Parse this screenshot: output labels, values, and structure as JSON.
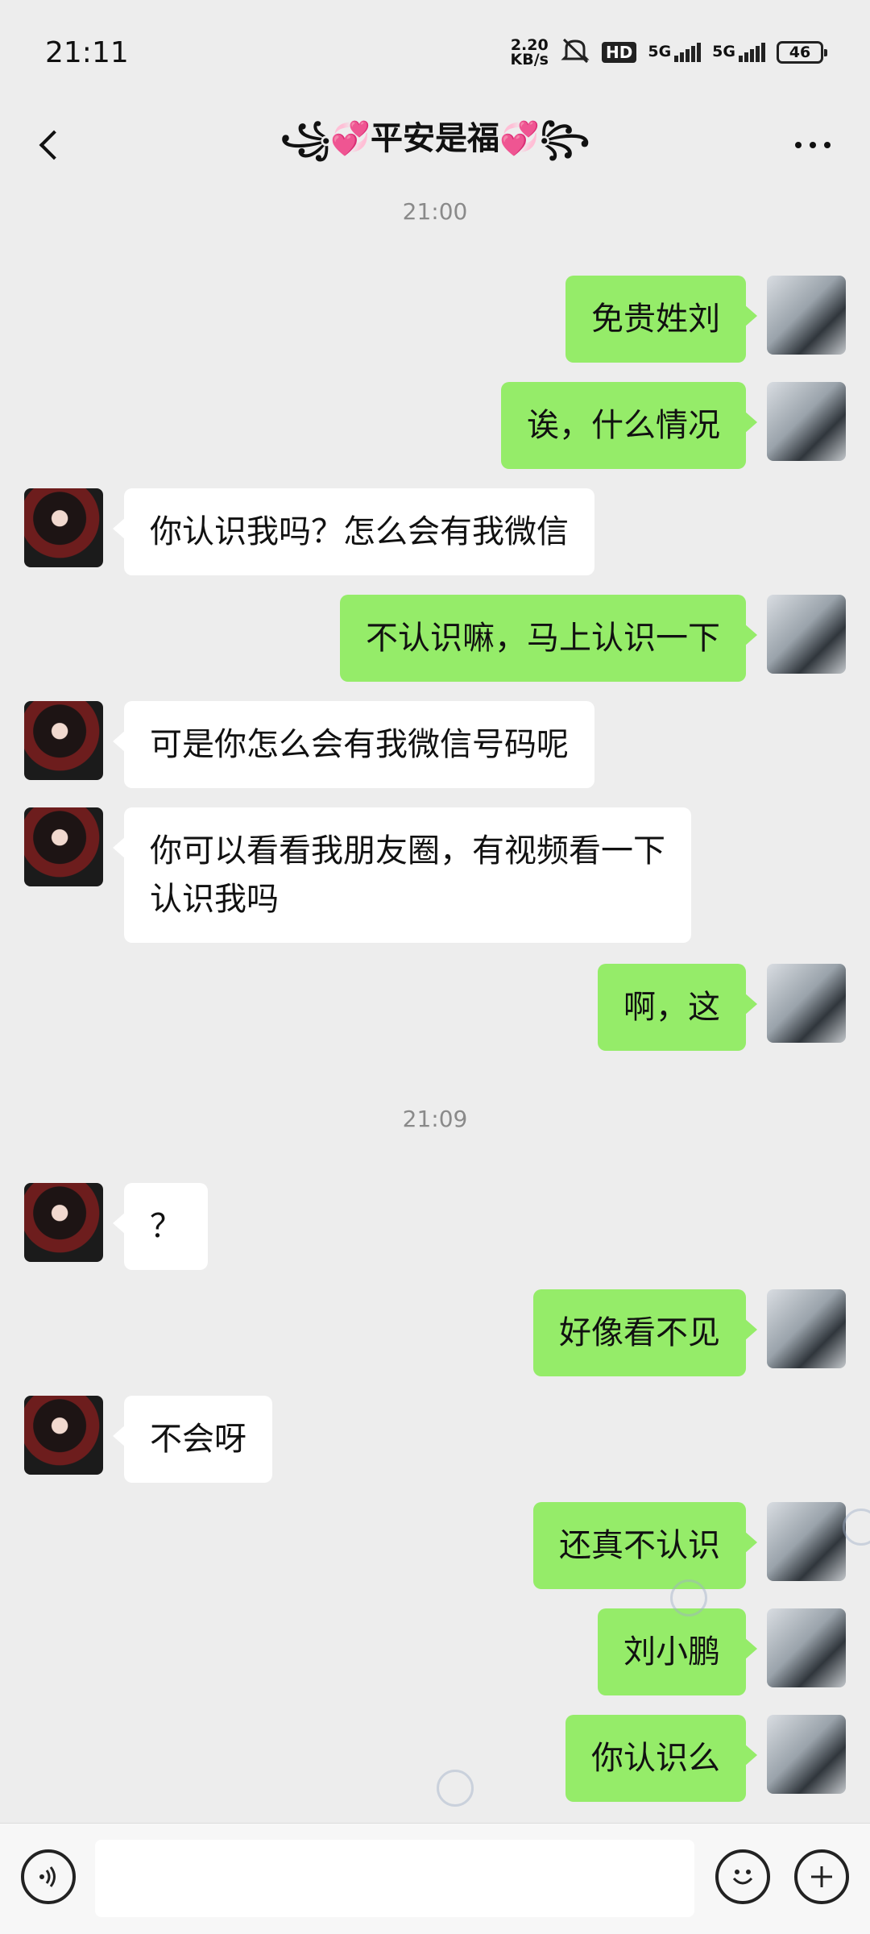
{
  "status_bar": {
    "time": "21:11",
    "net_speed_value": "2.20",
    "net_speed_unit": "KB/s",
    "hd_badge": "HD",
    "signal1_label": "5G",
    "signal2_label": "5G",
    "battery": "46"
  },
  "header": {
    "title": "꧁💞平安是福💞꧂",
    "icons": [
      "back-arrow-icon",
      "more-dots-icon"
    ]
  },
  "time_separators": [
    "21:00",
    "21:09"
  ],
  "messages": [
    {
      "from": "me",
      "text": "免贵姓刘"
    },
    {
      "from": "me",
      "text": "诶，什么情况"
    },
    {
      "from": "her",
      "text": "你认识我吗？怎么会有我微信"
    },
    {
      "from": "me",
      "text": "不认识嘛，马上认识一下"
    },
    {
      "from": "her",
      "text": "可是你怎么会有我微信号码呢"
    },
    {
      "from": "her",
      "text": "你可以看看我朋友圈，有视频看一下\n认识我吗"
    },
    {
      "from": "me",
      "text": "啊，这"
    },
    {
      "from": "her",
      "text": "？"
    },
    {
      "from": "me",
      "text": "好像看不见"
    },
    {
      "from": "her",
      "text": "不会呀"
    },
    {
      "from": "me",
      "text": "还真不认识"
    },
    {
      "from": "me",
      "text": "刘小鹏"
    },
    {
      "from": "me",
      "text": "你认识么"
    }
  ],
  "input_bar": {
    "placeholder": "",
    "icons": [
      "voice-icon",
      "emoji-icon",
      "plus-icon"
    ]
  },
  "colors": {
    "background": "#ededed",
    "my_bubble": "#95ec69",
    "their_bubble": "#ffffff"
  }
}
